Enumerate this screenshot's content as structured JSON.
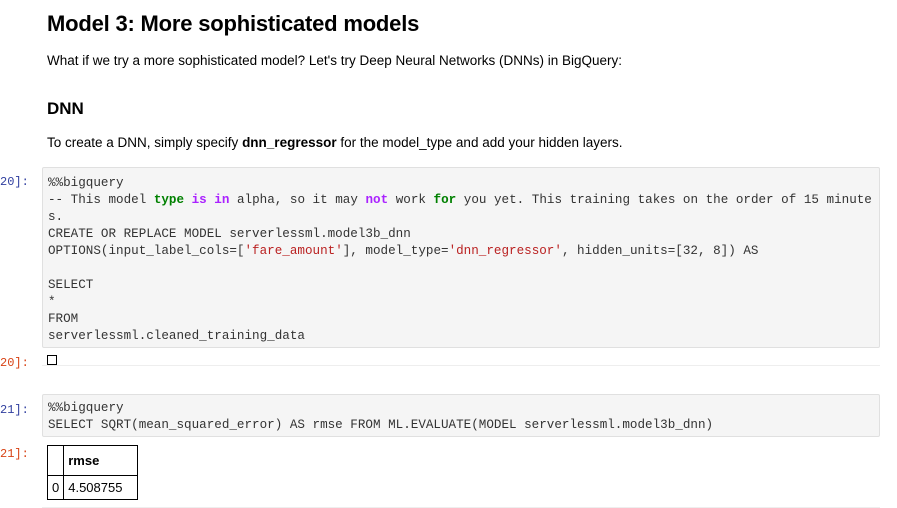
{
  "markdown": {
    "heading": "Model 3: More sophisticated models",
    "intro": "What if we try a more sophisticated model? Let's try Deep Neural Networks (DNNs) in BigQuery:",
    "subheading": "DNN",
    "instruction_prefix": "To create a DNN, simply specify ",
    "instruction_bold": "dnn_regressor",
    "instruction_suffix": " for the model_type and add your hidden layers."
  },
  "cells": [
    {
      "prompt": "20]:",
      "lines": {
        "l1": "%%bigquery",
        "l2a": "-- This model ",
        "l2_type": "type",
        "l2b": " ",
        "l2_is": "is",
        "l2c": " ",
        "l2_in": "in",
        "l2d": " alpha, so it may ",
        "l2_not": "not",
        "l2e": " work ",
        "l2_for": "for",
        "l2f": " you yet. This training takes on the order of 15 minutes.",
        "l3": "CREATE OR REPLACE MODEL serverlessml.model3b_dnn",
        "l4a": "OPTIONS(input_label_cols=[",
        "l4_str1": "'fare_amount'",
        "l4b": "], model_type=",
        "l4_str2": "'dnn_regressor'",
        "l4c": ", hidden_units=[32, 8]) AS",
        "l5": "",
        "l6": "SELECT",
        "l7": "*",
        "l8": "FROM",
        "l9": "serverlessml.cleaned_training_data"
      },
      "output_prompt": "20]:"
    },
    {
      "prompt": "21]:",
      "lines": {
        "l1": "%%bigquery",
        "l2": "SELECT SQRT(mean_squared_error) AS rmse FROM ML.EVALUATE(MODEL serverlessml.model3b_dnn)"
      },
      "output_prompt": "21]:",
      "table": {
        "columns": [
          "",
          "rmse"
        ],
        "rows": [
          [
            "0",
            "4.508755"
          ]
        ]
      }
    }
  ],
  "colors": {
    "input_prompt": "#303f9f",
    "output_prompt": "#d84315",
    "keyword_green": "#008000",
    "keyword_purple": "#aa22ff",
    "string": "#ba2121"
  }
}
